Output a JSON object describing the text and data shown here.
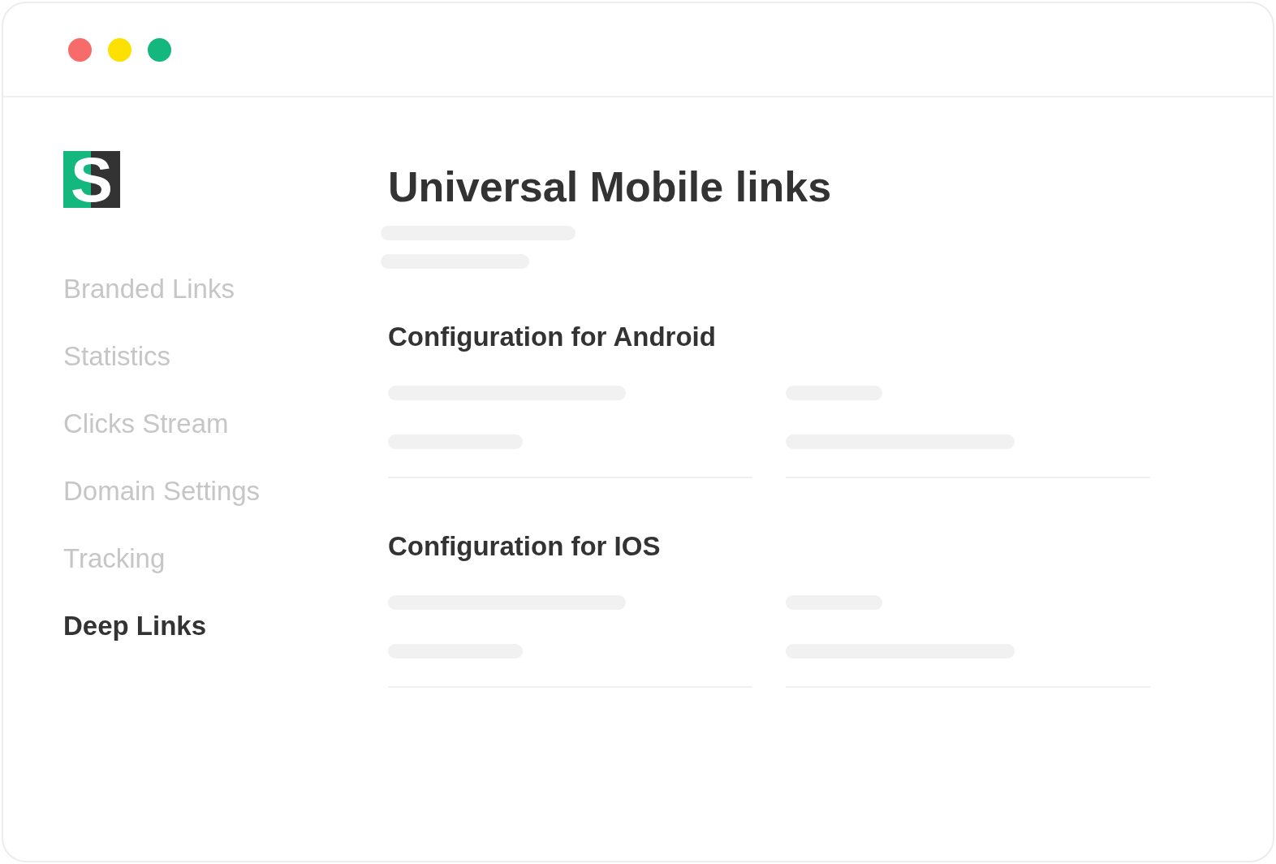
{
  "window": {
    "controls": [
      {
        "color": "#f76b6b"
      },
      {
        "color": "#fce100"
      },
      {
        "color": "#14b77e"
      }
    ]
  },
  "logo": {
    "letter": "S"
  },
  "sidebar": {
    "items": [
      {
        "label": "Branded Links",
        "selected": false
      },
      {
        "label": "Statistics",
        "selected": false
      },
      {
        "label": "Clicks Stream",
        "selected": false
      },
      {
        "label": "Domain Settings",
        "selected": false
      },
      {
        "label": "Tracking",
        "selected": false
      },
      {
        "label": "Deep Links",
        "selected": true
      }
    ]
  },
  "main": {
    "title": "Universal Mobile links",
    "sections": [
      {
        "heading": "Configuration for Android"
      },
      {
        "heading": "Configuration for IOS"
      }
    ]
  }
}
